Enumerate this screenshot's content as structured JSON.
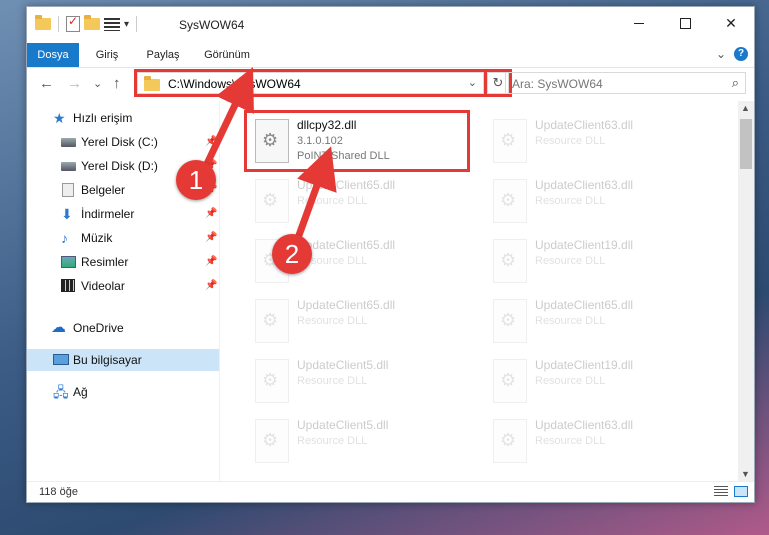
{
  "window": {
    "title": "SysWOW64",
    "controls": {
      "minimize": "—",
      "maximize": "",
      "close": "✕"
    }
  },
  "ribbon": {
    "tabs": [
      {
        "label": "Dosya",
        "active": true
      },
      {
        "label": "Giriş"
      },
      {
        "label": "Paylaş"
      },
      {
        "label": "Görünüm"
      }
    ],
    "collapse": "⌄",
    "help": "?"
  },
  "navigation": {
    "back": "←",
    "forward": "→",
    "recent": "⌄",
    "up": "↑",
    "address": "C:\\Windows\\SysWOW64",
    "address_chevron": "⌄",
    "refresh": "↻",
    "search_placeholder": "Ara: SysWOW64",
    "search_icon": "⌕"
  },
  "sidebar": {
    "quick_access": "Hızlı erişim",
    "items": [
      {
        "label": "Yerel Disk (C:)",
        "icon": "disk-icon",
        "pinned": true
      },
      {
        "label": "Yerel Disk (D:)",
        "icon": "disk-icon",
        "pinned": true
      },
      {
        "label": "Belgeler",
        "icon": "documents-icon",
        "pinned": true
      },
      {
        "label": "İndirmeler",
        "icon": "downloads-icon",
        "pinned": true
      },
      {
        "label": "Müzik",
        "icon": "music-icon",
        "pinned": true
      },
      {
        "label": "Resimler",
        "icon": "pictures-icon",
        "pinned": true
      },
      {
        "label": "Videolar",
        "icon": "videos-icon",
        "pinned": true
      }
    ],
    "onedrive": "OneDrive",
    "this_pc": "Bu bilgisayar",
    "network": "Ağ",
    "pin_glyph": "📌"
  },
  "files": {
    "highlighted": {
      "name": "dllcpy32.dll",
      "version": "3.1.0.102",
      "description": "PoINT Shared DLL"
    },
    "others": [
      {
        "name": "UpdateClient63.dll",
        "description": "Resource DLL"
      },
      {
        "name": "UpdateClient65.dll",
        "description": "Resource DLL"
      },
      {
        "name": "UpdateClient63.dll",
        "description": "Resource DLL"
      },
      {
        "name": "UpdateClient65.dll",
        "description": "Resource DLL"
      },
      {
        "name": "UpdateClient19.dll",
        "description": "Resource DLL"
      },
      {
        "name": "UpdateClient65.dll",
        "description": "Resource DLL"
      },
      {
        "name": "UpdateClient65.dll",
        "description": "Resource DLL"
      },
      {
        "name": "UpdateClient5.dll",
        "description": "Resource DLL"
      },
      {
        "name": "UpdateClient19.dll",
        "description": "Resource DLL"
      },
      {
        "name": "UpdateClient5.dll",
        "description": "Resource DLL"
      },
      {
        "name": "UpdateClient63.dll",
        "description": "Resource DLL"
      }
    ]
  },
  "status": {
    "count": "118 öğe"
  },
  "callouts": {
    "one": "1",
    "two": "2"
  },
  "colors": {
    "accent": "#1979ca",
    "highlight": "#e53935",
    "selected": "#cce4f7"
  }
}
